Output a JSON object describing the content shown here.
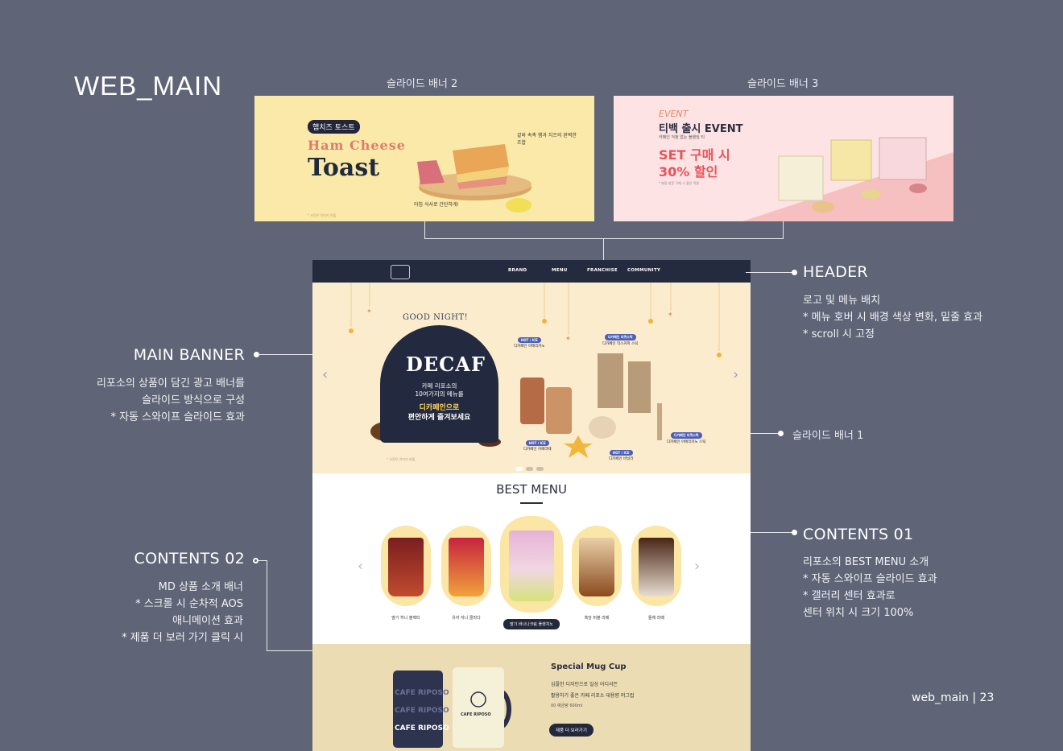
{
  "board": {
    "title": "WEB_MAIN",
    "page_number": "web_main | 23"
  },
  "slides": {
    "banner2_caption": "슬라이드 배너 2",
    "banner3_caption": "슬라이드 배너 3",
    "banner1_caption": "슬라이드 배너 1",
    "banner2": {
      "tag": "햄치즈 토스트",
      "title_line1": "Ham Cheese",
      "title_line2": "Toast",
      "note": "겉바 속촉 햄과 치즈의 완벽한 조합",
      "note2": "아침 식사로 간단하게!",
      "fine": "* 사진은 이미지 연출"
    },
    "banner3": {
      "event": "EVENT",
      "headline": "티백 출시 EVENT",
      "sub": "카페인 걱정 없는 블렌딩 티",
      "offer": "SET 구매 시\n30% 할인",
      "fine": "* 매장 방문 구매 시 할인 적용"
    }
  },
  "annotations": {
    "header": {
      "title": "HEADER",
      "text": "로고 및 메뉴 배치\n* 메뉴 호버 시 배경 색상 변화, 밑줄 효과\n* scroll 시 고정"
    },
    "main_banner": {
      "title": "MAIN BANNER",
      "text": "리포소의 상품이 담긴 광고 배너를\n슬라이드 방식으로 구성\n* 자동 스와이프 슬라이드 효과"
    },
    "contents01": {
      "title": "CONTENTS 01",
      "text": "리포소의 BEST MENU 소개\n* 자동 스와이프 슬라이드 효과\n* 갤러리 센터 효과로\n   센터 위치 시 크기 100%"
    },
    "contents02": {
      "title": "CONTENTS 02",
      "text": "MD 상품 소개 배너\n* 스크롤 시 순차적 AOS\n애니메이션 효과\n* 제품 더 보러 가기 클릭 시"
    }
  },
  "site": {
    "nav": [
      "BRAND",
      "MENU",
      "FRANCHISE",
      "COMMUNITY"
    ],
    "hero": {
      "good_night": "GOOD NIGHT!",
      "decaf": "DECAF",
      "line1": "카페 리포소의\n10여가지의 메뉴를",
      "line2a": "디카페인으로",
      "line2b": "편안하게 즐겨보세요",
      "fine": "* 사진은 이미지 연출",
      "items": [
        {
          "badge": "HOT / ICE",
          "name": "디카페인 아메리카노"
        },
        {
          "badge": "디카페인 리퀴스틱",
          "name": "디카페인 믹스커피 스틱"
        },
        {
          "badge": "HOT / ICE",
          "name": "디카페인 카페라떼"
        },
        {
          "badge": "HOT / ICE",
          "name": "디카페인 바닐라"
        },
        {
          "badge": "디카페인 리퀴스틱",
          "name": "디카페인 아메리카노 스틱"
        }
      ]
    },
    "best": {
      "title": "BEST MENU",
      "items": [
        {
          "label": "딸기 허니 블랙티"
        },
        {
          "label": "유자 자니 콜라다"
        },
        {
          "label": "딸기 바나나크림 플랫치노"
        },
        {
          "label": "흑당 버블 라떼"
        },
        {
          "label": "돌체 라떼"
        }
      ]
    },
    "mug": {
      "title": "Special Mug Cup",
      "text": "심플한 디자인으로 일상 어디서든\n활용하기 좋은 카페 리포소 대용량 머그컵",
      "volume": "00 예금량 600ml",
      "button": "제품 더 보러가기",
      "mug_text": "CAFE RIPOSO"
    }
  },
  "colors": {
    "background": "#5f6577",
    "navy": "#242b3e",
    "hero_bg": "#fbecce",
    "best_circle": "#fbe6a6",
    "mug_bg": "#ecdcb3",
    "banner2_bg": "#fbe9a9",
    "banner3_bg": "#fde3e3"
  }
}
